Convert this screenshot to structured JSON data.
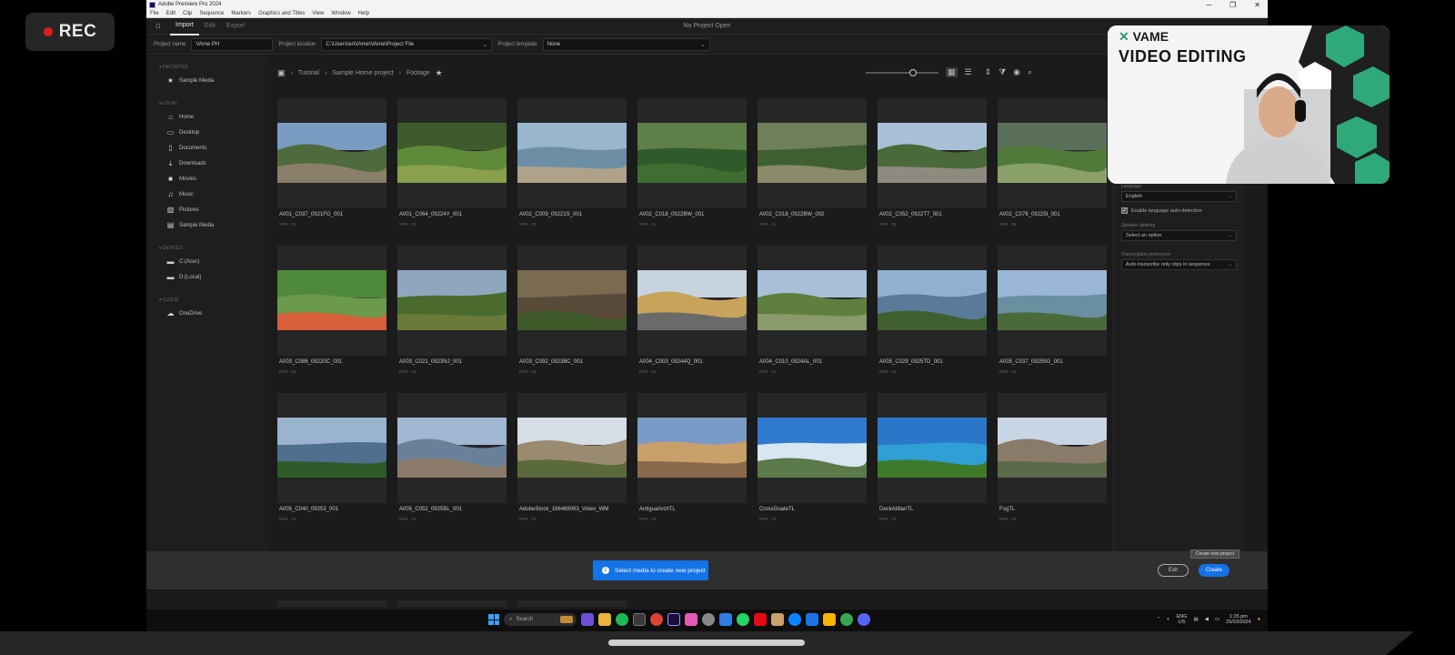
{
  "recording": {
    "label": "REC"
  },
  "window": {
    "title": "Adobe Premiere Pro 2024",
    "controls": [
      "─",
      "❐",
      "✕"
    ],
    "menu": [
      "File",
      "Edit",
      "Clip",
      "Sequence",
      "Markers",
      "Graphics and Titles",
      "View",
      "Window",
      "Help"
    ]
  },
  "workspace": {
    "tabs": [
      "Import",
      "Edit",
      "Export"
    ],
    "active_tab": "Import",
    "center_title": "No Project Open"
  },
  "project_bar": {
    "name_label": "Project name",
    "name_value": "VAme PH",
    "location_label": "Project location",
    "location_value": "C:\\Users\\eriVAme\\VAme\\Project File",
    "template_label": "Project template",
    "template_value": "None"
  },
  "sidebar": {
    "sections": [
      {
        "heading": "FAVORITES",
        "items": [
          {
            "label": "Sample Media",
            "icon": "star-icon"
          }
        ]
      },
      {
        "heading": "LOCAL",
        "items": [
          {
            "label": "Home",
            "icon": "home-icon"
          },
          {
            "label": "Desktop",
            "icon": "desktop-icon"
          },
          {
            "label": "Documents",
            "icon": "document-icon"
          },
          {
            "label": "Downloads",
            "icon": "download-icon"
          },
          {
            "label": "Movies",
            "icon": "movie-icon"
          },
          {
            "label": "Music",
            "icon": "music-icon"
          },
          {
            "label": "Pictures",
            "icon": "picture-icon"
          },
          {
            "label": "Sample Media",
            "icon": "media-icon"
          }
        ]
      },
      {
        "heading": "DEVICES",
        "items": [
          {
            "label": "C:(Acer)",
            "icon": "drive-icon"
          },
          {
            "label": "D:(Local)",
            "icon": "drive-icon"
          }
        ]
      },
      {
        "heading": "CLOUD",
        "items": [
          {
            "label": "OneDrive",
            "icon": "cloud-icon"
          }
        ]
      }
    ]
  },
  "breadcrumb": {
    "items": [
      "Tutorial",
      "Sample Home project",
      "Footage"
    ]
  },
  "media": {
    "rows": [
      [
        {
          "name": "A001_C037_0921FG_001",
          "meta": "MP4 · 02"
        },
        {
          "name": "A001_C064_09224Y_001",
          "meta": "MP4 · 02"
        },
        {
          "name": "A002_C009_09221S_001",
          "meta": "MP4 · 02"
        },
        {
          "name": "A002_C018_0922BW_001",
          "meta": "MP4 · 01"
        },
        {
          "name": "A002_C018_0922BW_002",
          "meta": "MP4 · 01"
        },
        {
          "name": "A002_C052_0922T7_001",
          "meta": "MP4 · 02"
        },
        {
          "name": "A002_C076_09225I_001",
          "meta": "MP4 · 05"
        }
      ],
      [
        {
          "name": "A003_C086_09220C_001",
          "meta": "MP4 · 02"
        },
        {
          "name": "A003_C021_0923NJ_001",
          "meta": "MP4 · 04"
        },
        {
          "name": "A003_C092_0923BC_001",
          "meta": "MP4 · 03"
        },
        {
          "name": "A004_C003_09244Q_001",
          "meta": "MP4 · 02"
        },
        {
          "name": "A004_C010_0924AL_001",
          "meta": "MP4 · 01"
        },
        {
          "name": "A005_C029_0925TD_001",
          "meta": "MP4 · 02"
        },
        {
          "name": "A005_C037_09255G_001",
          "meta": "MP4 · 02"
        }
      ],
      [
        {
          "name": "A005_C040_09253_001",
          "meta": "MP4 · 02"
        },
        {
          "name": "A005_C052_0925BL_001",
          "meta": "MP4 · 04"
        },
        {
          "name": "AdobeStock_166468063_Video_WM",
          "meta": "MP4 · 02"
        },
        {
          "name": "AntiguaArchTL",
          "meta": "MP4 · 03"
        },
        {
          "name": "CrossGuateTL",
          "meta": "MP4 · 02"
        },
        {
          "name": "DeckAtitlanTL",
          "meta": "MP4 · 02"
        },
        {
          "name": "FogTL",
          "meta": "MP4 · 04"
        }
      ]
    ]
  },
  "right_panel": {
    "language_label": "Language",
    "language_value": "English",
    "auto_detect_label": "Enable language auto-detection",
    "speaker_label": "Speaker labeling",
    "speaker_value": "Select an option",
    "clips_label": "Transcription preference",
    "clips_value": "Auto-transcribe only clips in sequence"
  },
  "footer": {
    "info_message": "Select media to create new project",
    "exit_label": "Exit",
    "create_label": "Create",
    "tooltip": "Create new project"
  },
  "taskbar": {
    "search_placeholder": "Search",
    "lang": "ENG",
    "lang_sub": "US",
    "time": "1:35 pm",
    "date": "25/03/2024"
  },
  "webcam": {
    "brand": "VAME",
    "title": "VIDEO EDITING"
  }
}
